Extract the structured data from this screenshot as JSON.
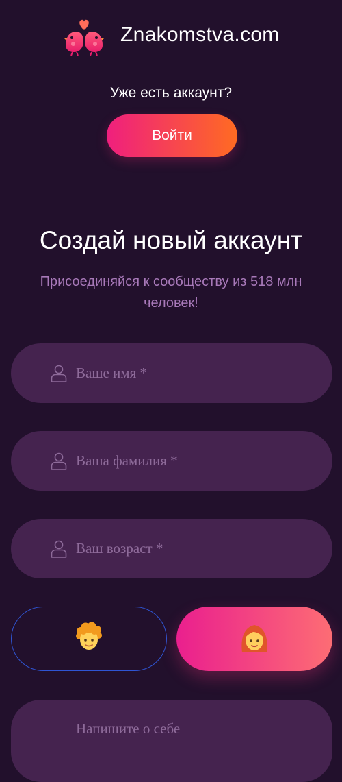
{
  "header": {
    "brand": "Znakomstva.com",
    "logo_icon": "lovebirds-logo-icon"
  },
  "login_section": {
    "prompt": "Уже есть аккаунт?",
    "login_label": "Войти"
  },
  "signup": {
    "title": "Создай новый аккаунт",
    "subtitle": "Присоединяйся к сообществу из 518 млн человек!",
    "fields": [
      {
        "placeholder": "Ваше имя *",
        "icon": "user-icon"
      },
      {
        "placeholder": "Ваша фамилия *",
        "icon": "user-icon"
      },
      {
        "placeholder": "Ваш возраст *",
        "icon": "user-icon"
      }
    ],
    "gender": {
      "male_icon": "man-face-icon",
      "female_icon": "woman-face-icon",
      "selected": "female"
    },
    "about_placeholder": "Напишите о себе"
  },
  "colors": {
    "background": "#22102c",
    "field_bg": "#45234f",
    "accent_start": "#ef1f7e",
    "accent_end": "#ff6b22",
    "subtitle": "#a879b9",
    "placeholder": "#8e6b9a",
    "male_border": "#2f55d4"
  }
}
